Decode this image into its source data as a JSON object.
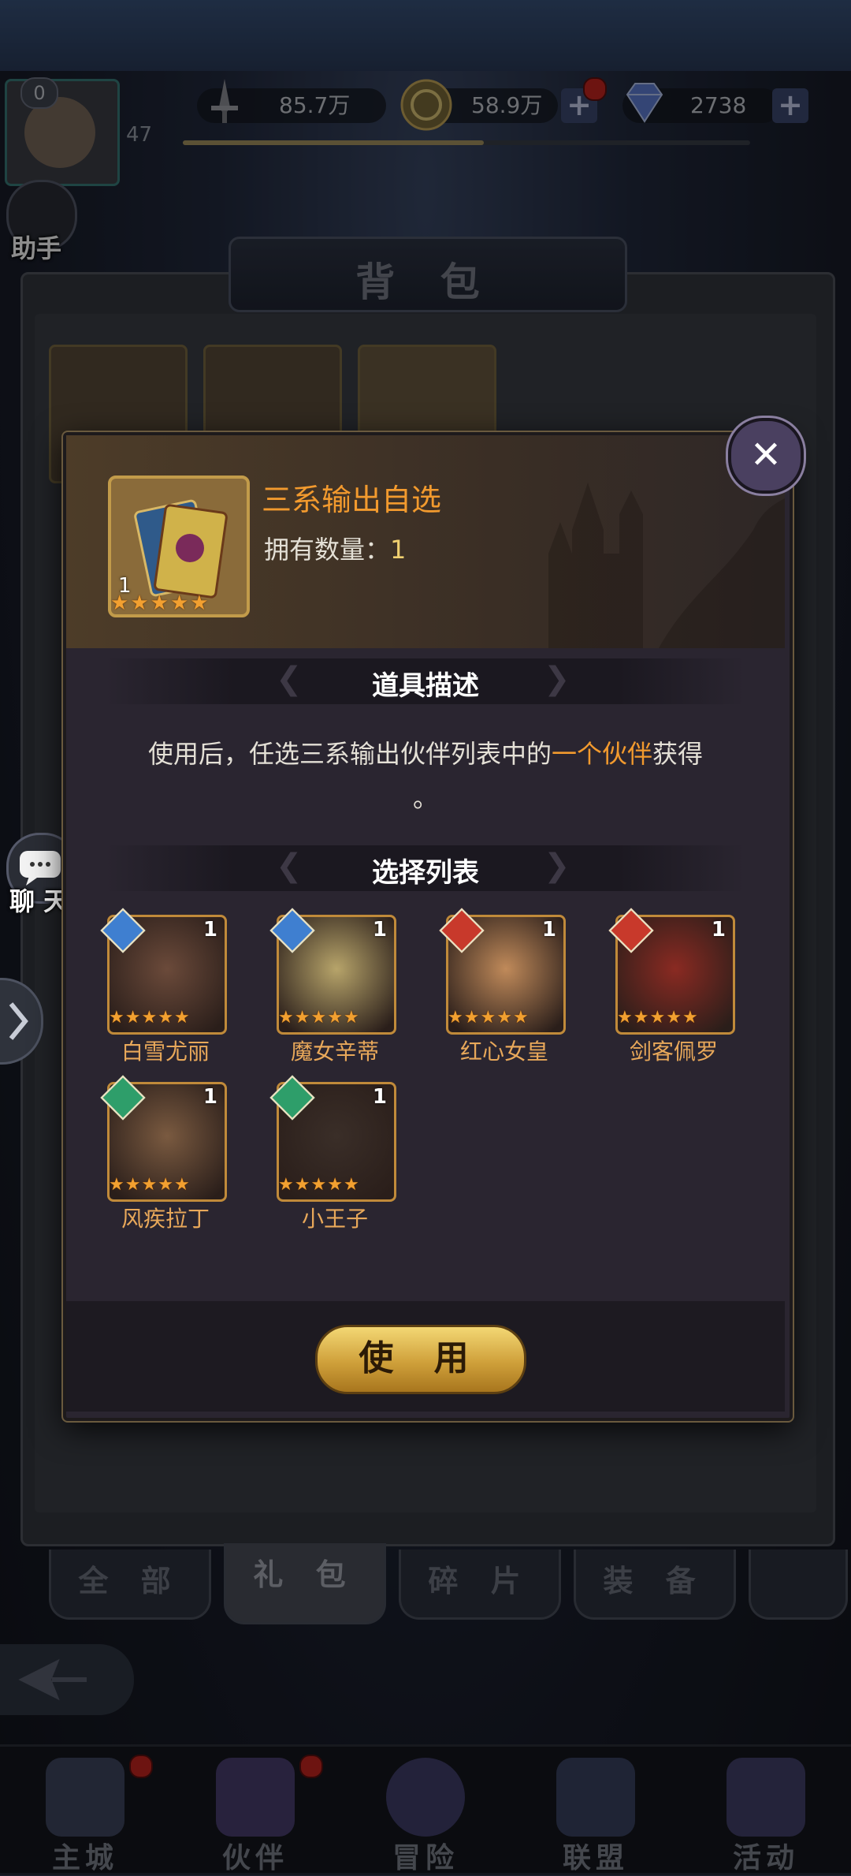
{
  "topbar": {
    "player_level": "47",
    "level_badge": "0",
    "exp_progress": 0.53,
    "power": "85.7万",
    "gold": "58.9万",
    "diamonds": "2738",
    "plus": "+"
  },
  "side": {
    "assistant": "助手",
    "chat": "聊 天"
  },
  "bag": {
    "title": "背 包",
    "tabs": [
      "全 部",
      "礼 包",
      "碎 片",
      "装 备"
    ],
    "active_tab_index": 1
  },
  "dialog": {
    "item_name": "三系输出自选",
    "own_label": "拥有数量：",
    "own_count": "1",
    "item_count": "1",
    "item_stars": 5,
    "desc_title": "道具描述",
    "desc_before": "使用后，任选三系输出伙伴列表中的",
    "desc_highlight": "一个伙伴",
    "desc_after": "获得",
    "desc_end": "。",
    "list_title": "选择列表",
    "use_button": "使 用",
    "close": "✕"
  },
  "heroes": [
    {
      "name": "白雪尤丽",
      "count": "1",
      "element": "water",
      "color": "#3f7fd0",
      "stars": 5
    },
    {
      "name": "魔女辛蒂",
      "count": "1",
      "element": "water",
      "color": "#3f7fd0",
      "stars": 5
    },
    {
      "name": "红心女皇",
      "count": "1",
      "element": "fire",
      "color": "#c8392b",
      "stars": 5
    },
    {
      "name": "剑客佩罗",
      "count": "1",
      "element": "fire",
      "color": "#c8392b",
      "stars": 5
    },
    {
      "name": "风疾拉丁",
      "count": "1",
      "element": "wind",
      "color": "#2e9e6a",
      "stars": 5
    },
    {
      "name": "小王子",
      "count": "1",
      "element": "wind",
      "color": "#2e9e6a",
      "stars": 5
    }
  ],
  "nav": [
    "主城",
    "伙伴",
    "冒险",
    "联盟",
    "活动"
  ],
  "colors": {
    "accent_orange": "#f29a2e",
    "gold_button": "#cfa03a",
    "badge_red": "#c7261f"
  }
}
